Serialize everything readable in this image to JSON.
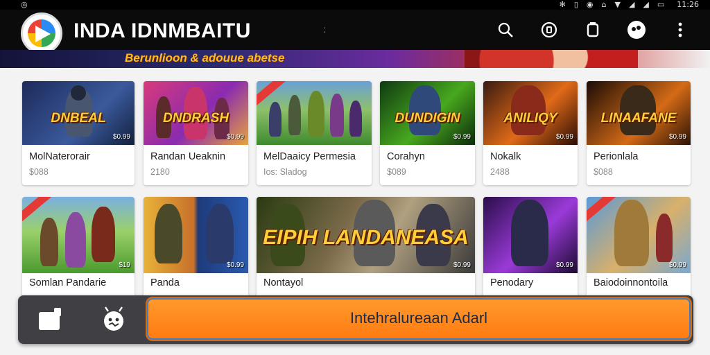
{
  "status_bar": {
    "time": "11:26"
  },
  "app": {
    "title": "INDA IDNMBAITU"
  },
  "banner": {
    "text": "Berunlioon & adouue abetse"
  },
  "games": [
    {
      "overlay": "DNBEAL",
      "price": "$0.99",
      "name": "MolNaterorair",
      "sub": "$088"
    },
    {
      "overlay": "DNDRASH",
      "price": "$0.99",
      "name": "Randan Ueaknin",
      "sub": "2180"
    },
    {
      "overlay": "",
      "price": "",
      "name": "MelDaaicy Permesia",
      "sub": "Ios: Sladog"
    },
    {
      "overlay": "DUNDIGIN",
      "price": "$0.99",
      "name": "Corahyn",
      "sub": "$089"
    },
    {
      "overlay": "ANILIQY",
      "price": "$0.99",
      "name": "Nokalk",
      "sub": "2488"
    },
    {
      "overlay": "LINAAFANE",
      "price": "$0.99",
      "name": "Perionlala",
      "sub": "$088"
    },
    {
      "overlay": "",
      "price": "$19",
      "name": "Somlan Pandarie",
      "sub": ""
    },
    {
      "overlay": "",
      "price": "$0.99",
      "name": "Panda",
      "sub": ""
    },
    {
      "overlay": "EIPIH LANDANEASA",
      "price": "$0.99",
      "name": "Nontayol",
      "sub": ""
    },
    {
      "overlay": "",
      "price": "$0.99",
      "name": "Penodary",
      "sub": ""
    },
    {
      "overlay": "",
      "price": "$0.99",
      "name": "Baiodoinnontoila",
      "sub": ""
    }
  ],
  "cta": {
    "label": "Intehralureaan Adarl"
  },
  "colors": {
    "accent": "#ff8a1e",
    "appbar": "#0b0b0b",
    "bottombar": "#3f3f44"
  },
  "icons": {
    "search": "search-icon",
    "refresh": "refresh-icon",
    "device": "device-icon",
    "profile": "profile-icon",
    "more": "more-vert-icon"
  }
}
